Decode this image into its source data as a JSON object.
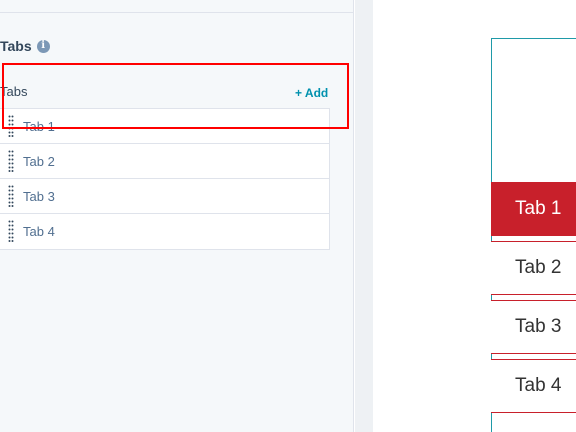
{
  "panel": {
    "section_title": "Tabs",
    "info_icon_glyph": "i",
    "list_label": "Tabs",
    "add_label": "+ Add",
    "items": [
      {
        "label": "Tab 1"
      },
      {
        "label": "Tab 2"
      },
      {
        "label": "Tab 3"
      },
      {
        "label": "Tab 4"
      }
    ]
  },
  "preview": {
    "tabs": [
      {
        "label": "Tab 1",
        "active": true
      },
      {
        "label": "Tab 2",
        "active": false
      },
      {
        "label": "Tab 3",
        "active": false
      },
      {
        "label": "Tab 4",
        "active": false
      }
    ],
    "active_color": "#c8202b",
    "frame_color": "#1f9aa8"
  },
  "colors": {
    "accent_link": "#0091ae",
    "highlight": "#ff0000",
    "panel_bg": "#f5f8fa"
  },
  "icons": {
    "info": "info-icon",
    "drag": "drag-handle-icon"
  }
}
